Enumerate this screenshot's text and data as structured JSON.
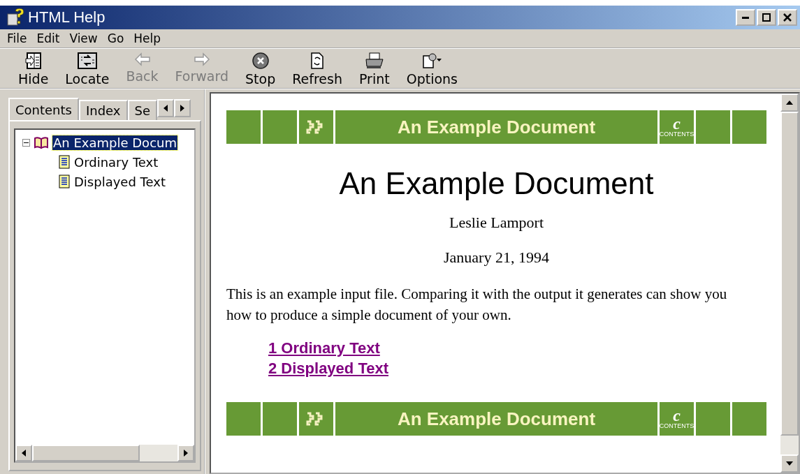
{
  "window": {
    "title": "HTML Help"
  },
  "menu": [
    "File",
    "Edit",
    "View",
    "Go",
    "Help"
  ],
  "toolbar": [
    {
      "kind": "hide",
      "label": "Hide",
      "disabled": false
    },
    {
      "kind": "locate",
      "label": "Locate",
      "disabled": false
    },
    {
      "kind": "back",
      "label": "Back",
      "disabled": true
    },
    {
      "kind": "forward",
      "label": "Forward",
      "disabled": true
    },
    {
      "kind": "stop",
      "label": "Stop",
      "disabled": false
    },
    {
      "kind": "refresh",
      "label": "Refresh",
      "disabled": false
    },
    {
      "kind": "print",
      "label": "Print",
      "disabled": false
    },
    {
      "kind": "options",
      "label": "Options",
      "disabled": false
    }
  ],
  "tabs": [
    {
      "label": "Contents",
      "selected": true
    },
    {
      "label": "Index",
      "selected": false
    },
    {
      "label": "Se",
      "selected": false
    }
  ],
  "tree": [
    {
      "label": "An Example Docum",
      "kind": "book",
      "expanded": true,
      "selected": true,
      "children": [
        {
          "label": "Ordinary Text",
          "kind": "page",
          "selected": false
        },
        {
          "label": "Displayed Text",
          "kind": "page",
          "selected": false
        }
      ]
    }
  ],
  "document": {
    "top_banner": {
      "title": "An Example Document",
      "contents_letter": "c",
      "contents_label": "CONTENTS"
    },
    "heading": "An Example Document",
    "author": "Leslie Lamport",
    "date": "January 21, 1994",
    "paragraph": "This is an example input file. Comparing it with the output it generates can show you how to produce a simple document of your own.",
    "links": [
      "1 Ordinary Text",
      "2 Displayed Text"
    ],
    "bottom_banner": {
      "title": "An Example Document",
      "contents_letter": "c",
      "contents_label": "CONTENTS"
    }
  }
}
